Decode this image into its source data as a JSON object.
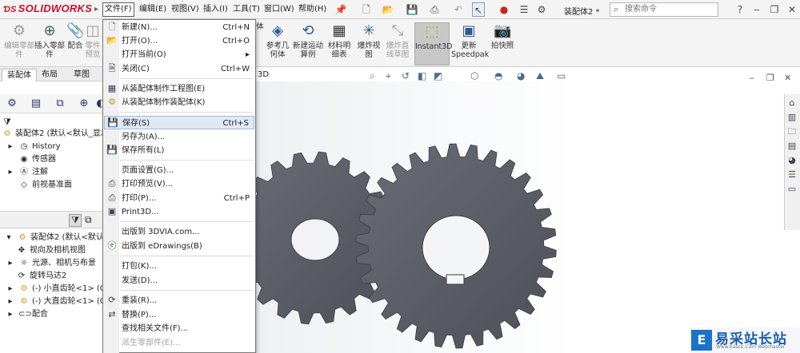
{
  "app": {
    "logo": "SOLIDWORKS",
    "window_title": "装配体2 *"
  },
  "menubar": [
    {
      "label": "文件(F)"
    },
    {
      "label": "编辑(E)"
    },
    {
      "label": "视图(V)"
    },
    {
      "label": "插入(I)"
    },
    {
      "label": "工具(T)"
    },
    {
      "label": "窗口(W)"
    },
    {
      "label": "帮助(H)"
    }
  ],
  "search": {
    "placeholder": "搜索命令"
  },
  "ribbon": {
    "buttons": [
      {
        "label": "编辑零部件",
        "icon": "edit-part-icon",
        "enabled": false
      },
      {
        "label": "插入零部件",
        "icon": "insert-part-icon",
        "enabled": true
      },
      {
        "label": "配合",
        "icon": "mate-icon",
        "enabled": true
      },
      {
        "label": "零件预览",
        "icon": "preview-icon",
        "enabled": false
      },
      {
        "label": "参考几何体",
        "icon": "ref-geometry-icon",
        "enabled": true
      },
      {
        "label": "新建运动算例",
        "icon": "motion-study-icon",
        "enabled": true
      },
      {
        "label": "材料明细表",
        "icon": "bom-icon",
        "enabled": true
      },
      {
        "label": "爆炸视图",
        "icon": "explode-icon",
        "enabled": true
      },
      {
        "label": "爆炸直线草图",
        "icon": "explode-line-icon",
        "enabled": false
      },
      {
        "label": "Instant3D",
        "icon": "instant3d-icon",
        "enabled": true,
        "selected": true
      },
      {
        "label": "更新Speedpak",
        "icon": "speedpak-icon",
        "enabled": true
      },
      {
        "label": "拍快照",
        "icon": "camera-icon",
        "enabled": true
      }
    ],
    "partial_label": "体"
  },
  "tabs": [
    {
      "label": "装配体"
    },
    {
      "label": "布局"
    },
    {
      "label": "草图"
    }
  ],
  "tab_partial": "3D",
  "tree_top": {
    "root": "装配体2 (默认<默认_显示状",
    "items": [
      {
        "label": "History"
      },
      {
        "label": "传感器"
      },
      {
        "label": "注解"
      },
      {
        "label": "前视基准面"
      }
    ]
  },
  "tree_bottom": {
    "root": "装配体2 (默认<默认_显",
    "items": [
      {
        "label": "视向及相机视图"
      },
      {
        "label": "光源、相机与布景"
      },
      {
        "label": "旋转马达2"
      },
      {
        "label": "(-) 小直齿轮<1> (G"
      },
      {
        "label": "(-) 大直齿轮<1> (G"
      },
      {
        "label": "配合"
      }
    ]
  },
  "file_menu": {
    "items": [
      {
        "label": "新建(N)...",
        "shortcut": "Ctrl+N",
        "icon": "new-file-icon"
      },
      {
        "label": "打开(O)...",
        "shortcut": "Ctrl+O",
        "icon": "open-folder-icon"
      },
      {
        "label": "打开当前(O)",
        "shortcut": "",
        "icon": ""
      },
      {
        "label": "关闭(C)",
        "shortcut": "Ctrl+W",
        "icon": "close-doc-icon"
      },
      {
        "label": "从装配体制作工程图(E)",
        "shortcut": "",
        "icon": "make-drawing-icon"
      },
      {
        "label": "从装配体制作装配体(K)",
        "shortcut": "",
        "icon": "make-assembly-icon"
      },
      {
        "label": "保存(S)",
        "shortcut": "Ctrl+S",
        "icon": "save-icon"
      },
      {
        "label": "另存为(A)...",
        "shortcut": "",
        "icon": ""
      },
      {
        "label": "保存所有(L)",
        "shortcut": "",
        "icon": "save-all-icon"
      },
      {
        "label": "页面设置(G)...",
        "shortcut": "",
        "icon": ""
      },
      {
        "label": "打印预览(V)...",
        "shortcut": "",
        "icon": "print-preview-icon"
      },
      {
        "label": "打印(P)...",
        "shortcut": "Ctrl+P",
        "icon": "print-icon"
      },
      {
        "label": "Print3D...",
        "shortcut": "",
        "icon": "print3d-icon"
      },
      {
        "label": "出版到 3DVIA.com...",
        "shortcut": "",
        "icon": ""
      },
      {
        "label": "出版到 eDrawings(B)",
        "shortcut": "",
        "icon": "edrawings-icon"
      },
      {
        "label": "打包(K)...",
        "shortcut": "",
        "icon": ""
      },
      {
        "label": "发送(D)...",
        "shortcut": "",
        "icon": ""
      },
      {
        "label": "重装(R)...",
        "shortcut": "",
        "icon": "reload-icon"
      },
      {
        "label": "替换(P)...",
        "shortcut": "",
        "icon": "replace-icon"
      },
      {
        "label": "查找相关文件(F)...",
        "shortcut": "",
        "icon": ""
      },
      {
        "label": "派生零部件(E)...",
        "shortcut": "",
        "icon": ""
      }
    ]
  },
  "watermark": {
    "title": "易采站长站",
    "subtitle": "Www.Easck.Com Webmaster"
  },
  "colors": {
    "accent": "#c8102e",
    "gear": "#5b5e66",
    "highlight": "#dfe8f5"
  }
}
